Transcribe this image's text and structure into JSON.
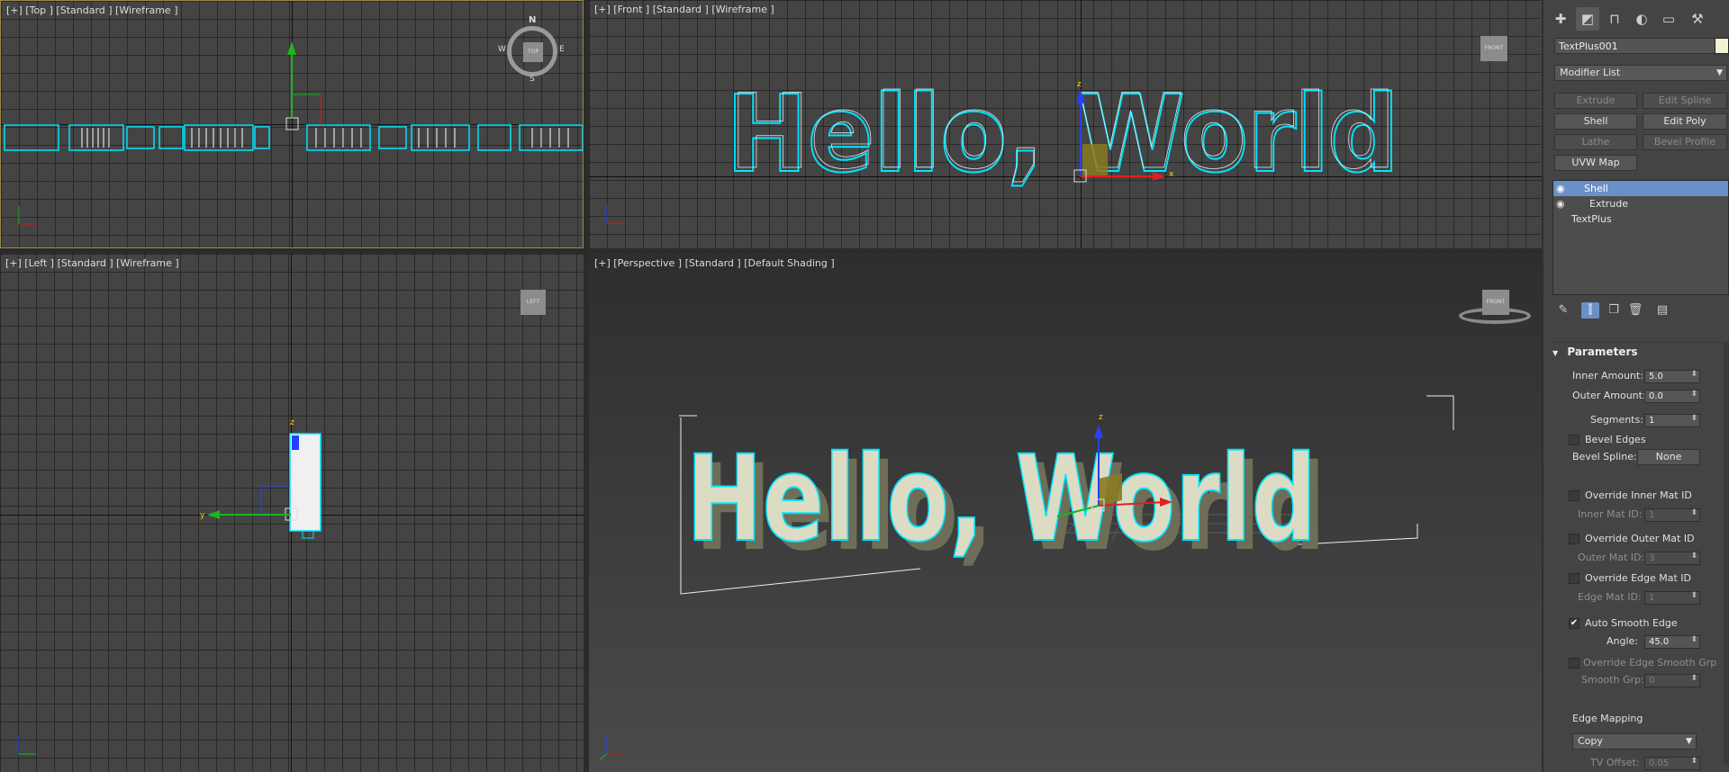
{
  "viewports": {
    "top": {
      "label": "[+] [Top ] [Standard ] [Wireframe ]",
      "viewcube": "TOP",
      "compass": {
        "n": "N",
        "s": "S",
        "e": "E",
        "w": "W"
      }
    },
    "front": {
      "label": "[+] [Front ] [Standard ] [Wireframe ]",
      "viewcube": "FRONT"
    },
    "left": {
      "label": "[+] [Left ] [Standard ] [Wireframe ]",
      "viewcube": "LEFT"
    },
    "perspective": {
      "label": "[+] [Perspective ] [Standard ] [Default Shading ]",
      "viewcube": "FRONT"
    }
  },
  "scene_text": "Hello, World",
  "axes": {
    "x": "x",
    "y": "y",
    "z": "z"
  },
  "panel": {
    "tabs": [
      "create-icon",
      "modify-icon",
      "hierarchy-icon",
      "motion-icon",
      "display-icon",
      "utilities-icon"
    ],
    "object_name": "TextPlus001",
    "object_color": "#f4f2d4",
    "modifier_list": "Modifier List",
    "modifier_buttons": [
      "Extrude",
      "Edit Spline",
      "Shell",
      "Edit Poly",
      "Lathe",
      "Bevel Profile",
      "UVW Map"
    ],
    "stack": [
      "Shell",
      "Extrude",
      "TextPlus"
    ],
    "rollout_title": "Parameters",
    "params": {
      "inner_amount_label": "Inner Amount:",
      "inner_amount": "5.0",
      "outer_amount_label": "Outer Amount:",
      "outer_amount": "0.0",
      "segments_label": "Segments:",
      "segments": "1",
      "bevel_edges": "Bevel Edges",
      "bevel_spline_label": "Bevel Spline:",
      "bevel_spline": "None",
      "override_inner": "Override Inner Mat ID",
      "inner_mat_label": "Inner Mat ID:",
      "inner_mat": "1",
      "override_outer": "Override Outer Mat ID",
      "outer_mat_label": "Outer Mat ID:",
      "outer_mat": "3",
      "override_edge": "Override Edge Mat ID",
      "edge_mat_label": "Edge Mat ID:",
      "edge_mat": "1",
      "auto_smooth": "Auto Smooth Edge",
      "angle_label": "Angle:",
      "angle": "45.0",
      "override_smooth": "Override Edge Smooth Grp",
      "smooth_grp_label": "Smooth Grp:",
      "smooth_grp": "0",
      "edge_mapping_label": "Edge Mapping",
      "edge_mapping": "Copy",
      "tv_offset_label": "TV Offset:",
      "tv_offset": "0.05"
    },
    "check_mark": "✔"
  },
  "colors": {
    "accent": "#6b8fc7",
    "wire": "#00e5ff",
    "grid": "#444444"
  }
}
